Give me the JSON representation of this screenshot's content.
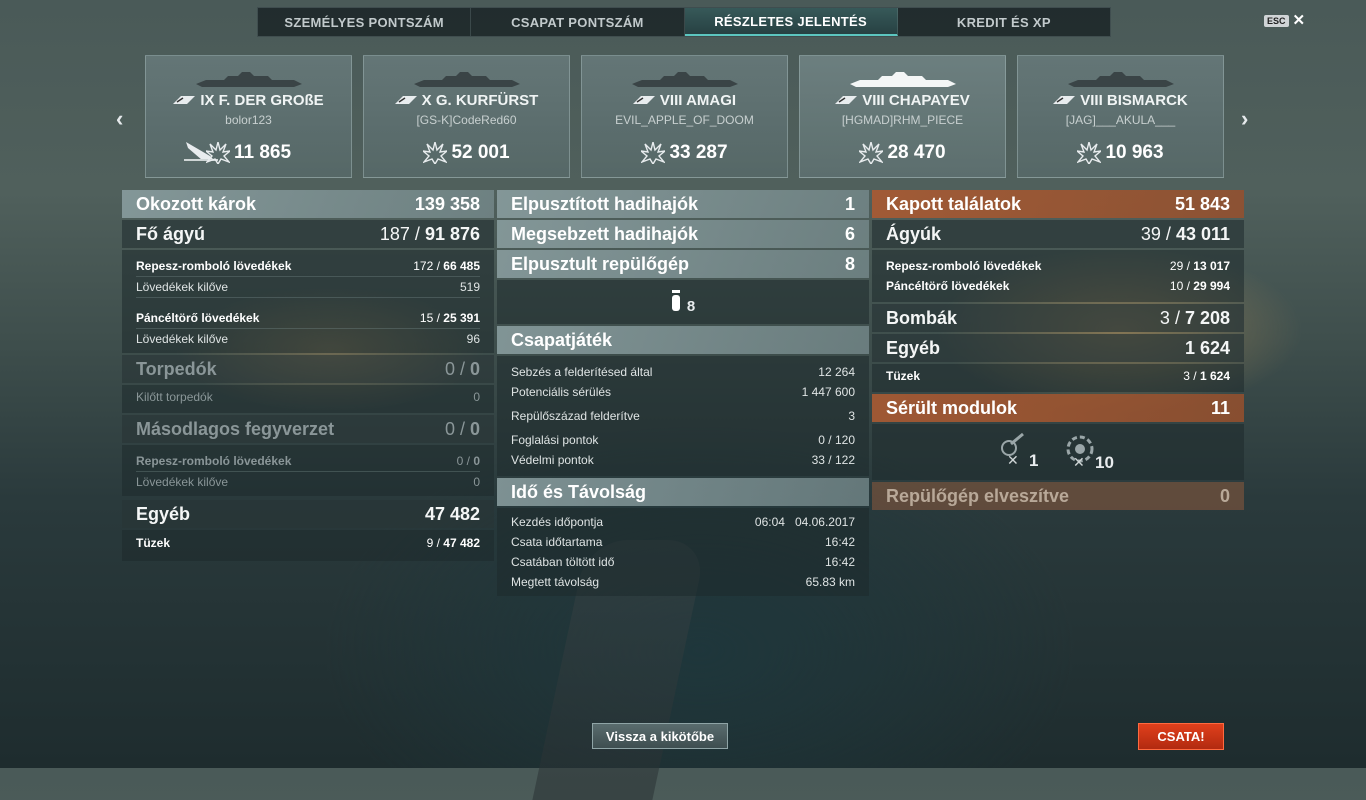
{
  "tabs": [
    {
      "label": "SZEMÉLYES PONTSZÁM"
    },
    {
      "label": "CSAPAT PONTSZÁM"
    },
    {
      "label": "RÉSZLETES JELENTÉS"
    },
    {
      "label": "KREDIT ÉS XP"
    }
  ],
  "active_tab": "RÉSZLETES JELENTÉS",
  "esc_label": "ESC",
  "ships": [
    {
      "tier": "IX",
      "name": "F. DER GROßE",
      "player": "bolor123",
      "score": "11 865"
    },
    {
      "tier": "X",
      "name": "G. KURFÜRST",
      "player": "[GS-K]CodeRed60",
      "score": "52 001"
    },
    {
      "tier": "VIII",
      "name": "AMAGI",
      "player": "EVIL_APPLE_OF_DOOM",
      "score": "33 287"
    },
    {
      "tier": "VIII",
      "name": "CHAPAYEV",
      "player": "[HGMAD]RHM_PIECE",
      "score": "28 470"
    },
    {
      "tier": "VIII",
      "name": "BISMARCK",
      "player": "[JAG]___AKULA___",
      "score": "10 963"
    }
  ],
  "left": {
    "damage": {
      "label": "Okozott károk",
      "value": "139 358"
    },
    "main": {
      "label": "Fő ágyú",
      "hits": "187",
      "dmg": "91 876"
    },
    "he": {
      "label": "Repesz-romboló lövedékek",
      "hits": "172",
      "dmg": "66 485"
    },
    "he_fired": {
      "label": "Lövedékek kilőve",
      "value": "519"
    },
    "ap": {
      "label": "Páncéltörő lövedékek",
      "hits": "15",
      "dmg": "25 391"
    },
    "ap_fired": {
      "label": "Lövedékek kilőve",
      "value": "96"
    },
    "torp": {
      "label": "Torpedók",
      "hits": "0",
      "dmg": "0"
    },
    "torp_fired": {
      "label": "Kilőtt torpedók",
      "value": "0"
    },
    "secondary": {
      "label": "Másodlagos fegyverzet",
      "hits": "0",
      "dmg": "0"
    },
    "sec_he": {
      "label": "Repesz-romboló lövedékek",
      "hits": "0",
      "dmg": "0"
    },
    "sec_fired": {
      "label": "Lövedékek kilőve",
      "value": "0"
    },
    "other": {
      "label": "Egyéb",
      "value": "47 482"
    },
    "fires": {
      "label": "Tüzek",
      "hits": "9",
      "dmg": "47 482"
    }
  },
  "mid": {
    "destroyed": {
      "label": "Elpusztított hadihajók",
      "value": "1"
    },
    "damaged": {
      "label": "Megsebzett hadihajók",
      "value": "6"
    },
    "planes": {
      "label": "Elpusztult repülőgép",
      "value": "8"
    },
    "plane_icon_count": "8",
    "team_title": "Csapatjáték",
    "team": [
      {
        "label": "Sebzés a felderítésed által",
        "value": "12 264"
      },
      {
        "label": "Potenciális sérülés",
        "value": "1 447 600"
      },
      {
        "label": "Repülőszázad felderítve",
        "value": "3"
      },
      {
        "label": "Foglalási pontok",
        "value": "0 / 120"
      },
      {
        "label": "Védelmi pontok",
        "value": "33 / 122"
      }
    ],
    "time_title": "Idő és Távolság",
    "start": {
      "label": "Kezdés időpontja",
      "time": "06:04",
      "date": "04.06.2017"
    },
    "duration": {
      "label": "Csata időtartama",
      "value": "16:42"
    },
    "time_in": {
      "label": "Csatában töltött idő",
      "value": "16:42"
    },
    "distance": {
      "label": "Megtett távolság",
      "value": "65.83 km"
    }
  },
  "right": {
    "received": {
      "label": "Kapott találatok",
      "value": "51 843"
    },
    "guns": {
      "label": "Ágyúk",
      "hits": "39",
      "dmg": "43 011"
    },
    "he": {
      "label": "Repesz-romboló lövedékek",
      "hits": "29",
      "dmg": "13 017"
    },
    "ap": {
      "label": "Páncéltörő lövedékek",
      "hits": "10",
      "dmg": "29 994"
    },
    "bombs": {
      "label": "Bombák",
      "hits": "3",
      "dmg": "7 208"
    },
    "other": {
      "label": "Egyéb",
      "value": "1 624"
    },
    "fires": {
      "label": "Tüzek",
      "hits": "3",
      "dmg": "1 624"
    },
    "modules": {
      "label": "Sérült modulok",
      "value": "11"
    },
    "module_icons": [
      {
        "count": "1"
      },
      {
        "count": "10"
      }
    ],
    "planes_lost": {
      "label": "Repülőgép elveszítve",
      "value": "0"
    }
  },
  "buttons": {
    "port": "Vissza a kikötőbe",
    "battle": "CSATA!"
  },
  "colors": {
    "accent": "#5cc6c0",
    "battle": "#d2361a",
    "received": "#a85a32"
  }
}
